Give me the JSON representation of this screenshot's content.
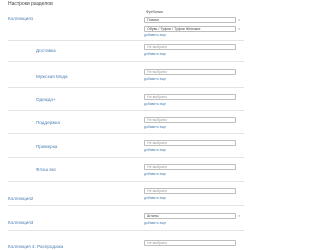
{
  "section_title": "Настроки разделов",
  "add_more_label": "добавить еще",
  "placeholder": "Не выбрано",
  "rows": {
    "collection1": {
      "label": "Коллекция1",
      "tags": [
        "Футболки",
        "Платье",
        "Обувь / Туфли / Туфли Женские"
      ]
    },
    "delivery": {
      "label": "Доставка"
    },
    "mens_fashion": {
      "label": "Мужская Мода"
    },
    "clothing": {
      "label": "Одежда+"
    },
    "support": {
      "label": "Поддержка"
    },
    "fitting": {
      "label": "Примерка"
    },
    "flash": {
      "label": "Флэш вкс"
    },
    "collection2": {
      "label": "Коллекция2"
    },
    "collection3": {
      "label": "Коллекция3",
      "value": "Штаны"
    },
    "collection4": {
      "label": "Коллекция 4: Распродажа"
    }
  }
}
